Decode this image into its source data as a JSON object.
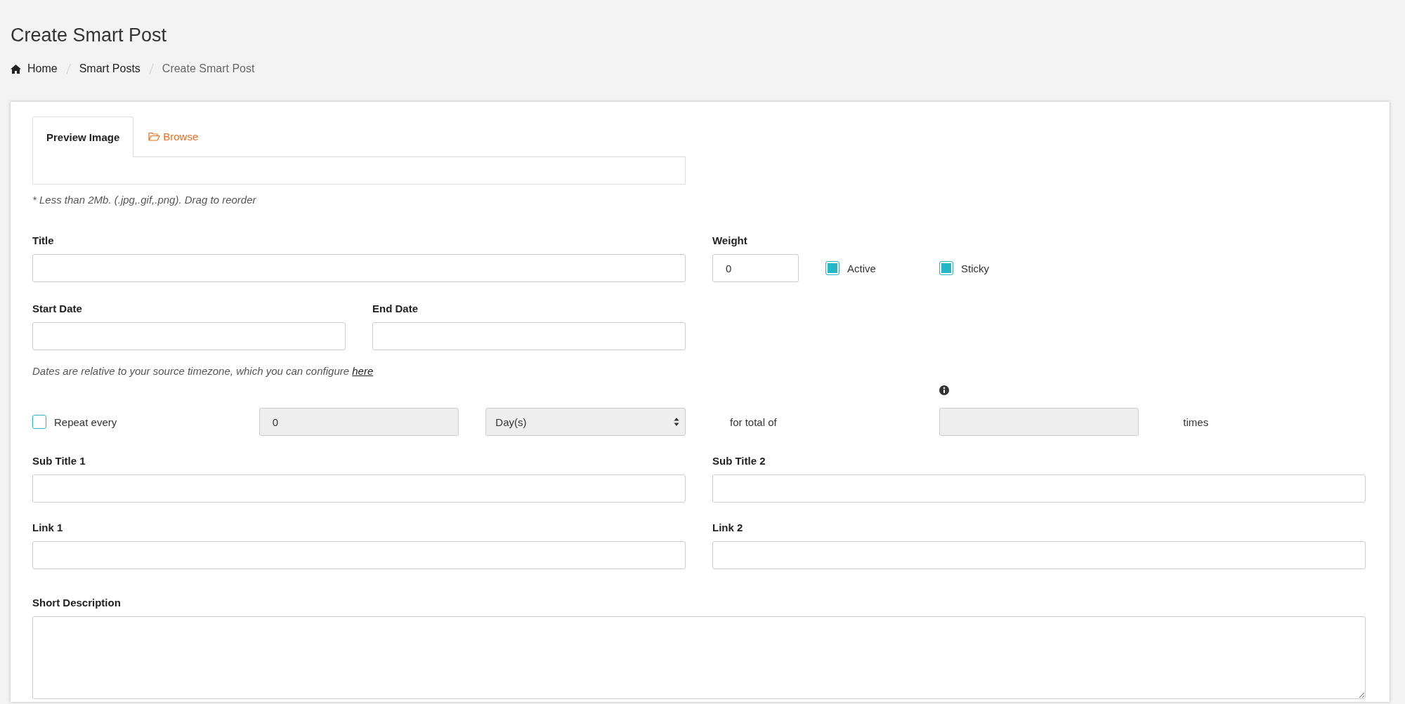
{
  "page": {
    "title": "Create Smart Post"
  },
  "breadcrumb": [
    {
      "label": "Home",
      "kind": "home"
    },
    {
      "label": "Smart Posts",
      "kind": "link"
    },
    {
      "label": "Create Smart Post",
      "kind": "current"
    }
  ],
  "image_tabs": [
    {
      "label": "Preview Image",
      "selected": true,
      "kind": "tab"
    },
    {
      "label": "Browse",
      "selected": false,
      "kind": "browse"
    }
  ],
  "image_note": "* Less than 2Mb. (.jpg,.gif,.png). Drag to reorder",
  "title_field": {
    "label": "Title"
  },
  "weight_field": {
    "label": "Weight",
    "value": "0"
  },
  "flags": [
    {
      "label": "Active",
      "checked": true
    },
    {
      "label": "Sticky",
      "checked": true
    }
  ],
  "start_date": {
    "label": "Start Date"
  },
  "end_date": {
    "label": "End Date"
  },
  "date_note": {
    "text": "Dates are relative to your source timezone, which you can configure ",
    "link": "here"
  },
  "repeat": {
    "label": "Repeat every",
    "checked": false,
    "interval": {
      "value": "0",
      "disabled": true
    },
    "unit": {
      "value": "Day(s)",
      "disabled": true
    },
    "total_label": "for total of",
    "count": {
      "disabled": true
    },
    "times_label": "times"
  },
  "subtitles": [
    {
      "label": "Sub Title 1"
    },
    {
      "label": "Sub Title 2"
    }
  ],
  "links": [
    {
      "label": "Link 1"
    },
    {
      "label": "Link 2"
    }
  ],
  "short_description": {
    "label": "Short Description"
  }
}
